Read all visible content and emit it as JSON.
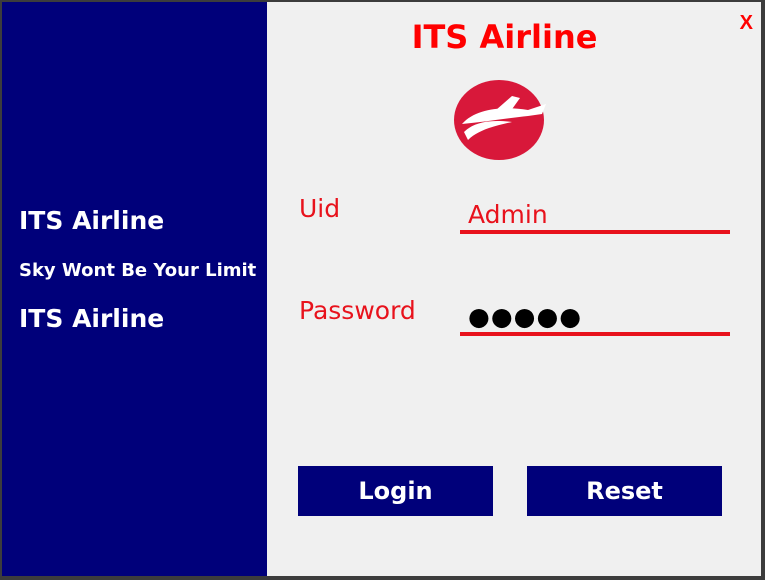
{
  "left_panel": {
    "line1": "ITS Airline",
    "tagline": "Sky Wont Be Your Limit",
    "line2": "ITS Airline"
  },
  "form": {
    "close_label": "X",
    "title": "ITS Airline",
    "uid_label": "Uid",
    "uid_value": "Admin",
    "password_label": "Password",
    "password_value": "●●●●●",
    "login_label": "Login",
    "reset_label": "Reset"
  },
  "colors": {
    "panel_blue": "#00007a",
    "accent_red": "#e8121c",
    "window_bg": "#f0f0f0"
  },
  "icons": {
    "logo": "airplane-logo-icon"
  }
}
